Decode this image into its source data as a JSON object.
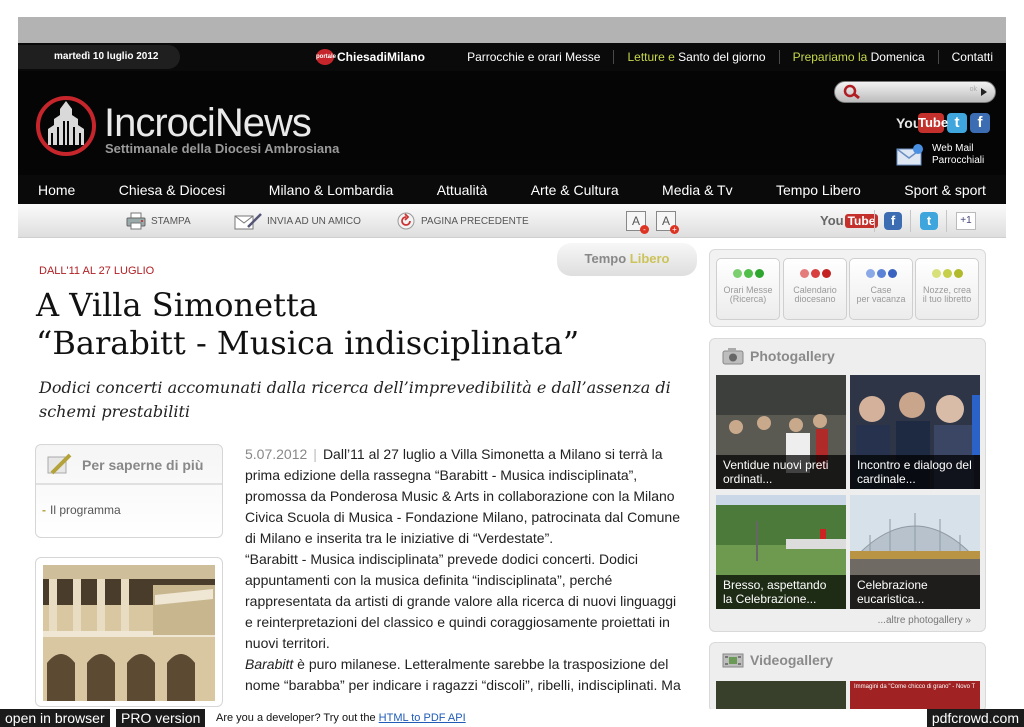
{
  "topbar": {
    "date": "martedì 10 luglio 2012",
    "portal_prefix": "portale",
    "portal_name": "ChiesadiMilano",
    "links": [
      {
        "pre": "",
        "label": "Parrocchie e orari Messe"
      },
      {
        "pre": "Letture e",
        "label": " Santo del giorno"
      },
      {
        "pre": "Prepariamo la",
        "label": " Domenica"
      },
      {
        "pre": "",
        "label": "Contatti"
      }
    ]
  },
  "header": {
    "title": "IncrociNews",
    "subtitle": "Settimanale della Diocesi Ambrosiana",
    "search_go": "ok",
    "youtube_you": "You",
    "youtube_tube": "Tube",
    "twitter": "t",
    "facebook": "f",
    "webmail": "Web Mail",
    "webmail2": "Parrocchiali"
  },
  "nav": [
    "Home",
    "Chiesa & Diocesi",
    "Milano & Lombardia",
    "Attualità",
    "Arte & Cultura",
    "Media & Tv",
    "Tempo Libero",
    "Sport & sport"
  ],
  "tools": {
    "print": "STAMPA",
    "send": "INVIA AD UN AMICO",
    "back": "PAGINA PRECEDENTE",
    "font_letter": "A",
    "font_minus": "-",
    "font_plus": "+",
    "yt_you": "You",
    "yt_tube": "Tube",
    "fb": "f",
    "tw": "t",
    "plus": "+1"
  },
  "section_tab": {
    "pre": "Tempo",
    "accent": " Libero"
  },
  "article": {
    "kicker": "DALL'11 AL 27 LUGLIO",
    "title_line1": "A Villa Simonetta",
    "title_line2": "“Barabitt - Musica indisciplinata”",
    "subtitle": "Dodici concerti accomunati dalla ricerca dell’imprevedibilità e dall’assenza di schemi prestabiliti",
    "date": "5.07.2012",
    "p1": "Dall’11 al 27 luglio a Villa Simonetta a Milano si terrà la prima edizione della rassegna “Barabitt - Musica indisciplinata”, promossa da Ponderosa Music & Arts in collaborazione con la Milano Civica Scuola di Musica - Fondazione Milano, patrocinata dal Comune di Milano e inserita tra le iniziative di “Verdestate”.",
    "p2": "“Barabitt - Musica indisciplinata” prevede dodici concerti. Dodici appuntamenti con la musica definita “indisciplinata”, perché rappresentata da artisti di grande valore alla ricerca di nuovi linguaggi e reinterpretazioni del classico e quindi coraggiosamente proiettati in nuovi territori.",
    "p3_em": "Barabitt",
    "p3": " è puro milanese. Letteralmente sarebbe la trasposizione del nome “barabba” per indicare i ragazzi “discoli”, ribelli, indisciplinati. Ma"
  },
  "more": {
    "title": "Per saperne di più",
    "item": "Il programma"
  },
  "side_icons": [
    {
      "label1": "Orari Messe",
      "label2": "(Ricerca)",
      "colors": [
        "#7ccf6f",
        "#4fbf4a",
        "#2ea52e"
      ]
    },
    {
      "label1": "Calendario",
      "label2": "diocesano",
      "colors": [
        "#e57b7b",
        "#d84040",
        "#c42222"
      ]
    },
    {
      "label1": "Case",
      "label2": "per vacanza",
      "colors": [
        "#8aa9e6",
        "#5a83d8",
        "#3a62c0"
      ]
    },
    {
      "label1": "Nozze, crea",
      "label2": "il tuo libretto",
      "colors": [
        "#d8e07a",
        "#c6cf4a",
        "#b0ba2a"
      ]
    }
  ],
  "photogallery": {
    "title": "Photogallery",
    "items": [
      {
        "caption": "Ventidue nuovi preti ordinati..."
      },
      {
        "caption": "Incontro e dialogo del cardinale..."
      },
      {
        "caption": "Bresso, aspettando la Celebrazione..."
      },
      {
        "caption": "Celebrazione eucaristica..."
      }
    ],
    "more": "...altre photogallery »"
  },
  "videogallery": {
    "title": "Videogallery",
    "thumb_text": "Immagini da \"Come chicco di grano\" - Novo T"
  },
  "footer": {
    "open_browser": "open in browser",
    "pro": "PRO version",
    "dev_text": "Are you a developer? Try out the ",
    "dev_link": "HTML to PDF API",
    "brand": "pdfcrowd.com"
  }
}
